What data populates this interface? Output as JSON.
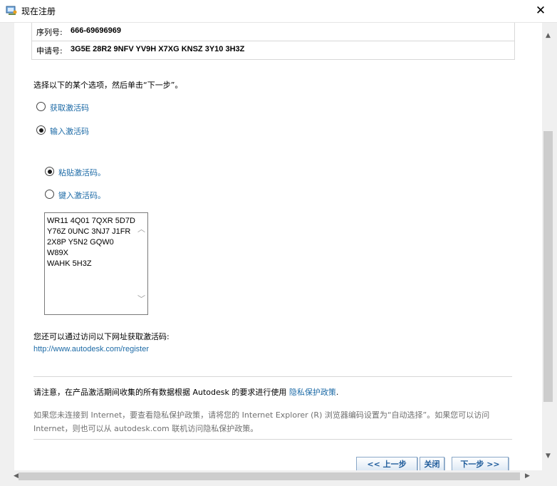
{
  "window": {
    "title": "现在注册",
    "close_glyph": "✕"
  },
  "info": {
    "serial_label": "序列号:",
    "serial_value": "666-69696969",
    "request_label": "申请号:",
    "request_value": "3G5E 28R2 9NFV YV9H X7XG KNSZ 3Y10 3H3Z"
  },
  "instruction": "选择以下的某个选项，然后单击“下一步”。",
  "options": {
    "get_code": {
      "label": "获取激活码",
      "checked": false
    },
    "enter_code": {
      "label": "输入激活码",
      "checked": true
    }
  },
  "sub_options": {
    "paste": {
      "label": "粘贴激活码。",
      "checked": true
    },
    "type": {
      "label": "键入激活码。",
      "checked": false
    }
  },
  "activation_code_lines": "WR11 4Q01 7QXR 5D7D\nY76Z 0UNC 3NJ7 J1FR\n2X8P Y5N2 GQW0\nW89X\nWAHK 5H3Z",
  "also_text": "您还可以通过访问以下网址获取激活码:",
  "register_url": "http://www.autodesk.com/register",
  "privacy_notice": {
    "text": "请注意，在产品激活期间收集的所有数据根据 Autodesk 的要求进行使用 ",
    "link": "隐私保护政策",
    "period": "."
  },
  "gray_note": "如果您未连接到 Internet，要查看隐私保护政策，请将您的 Internet Explorer (R) 浏览器编码设置为“自动选择”。如果您可以访问 Internet，则也可以从 autodesk.com 联机访问隐私保护政策。",
  "buttons": {
    "back": "<< 上一步",
    "close": "关闭",
    "next": "下一步 >>"
  },
  "scrollbars": {
    "up_glyph": "▲",
    "down_glyph": "▼",
    "left_glyph": "◀",
    "right_glyph": "▶"
  },
  "colors": {
    "link": "#1c6aa6",
    "button_text": "#1c5a9a",
    "gray_text": "#707070"
  }
}
